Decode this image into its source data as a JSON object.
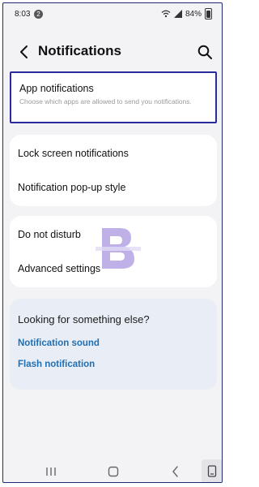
{
  "status_bar": {
    "time": "8:03",
    "notification_count": "2",
    "battery": "84%"
  },
  "header": {
    "title": "Notifications"
  },
  "app_notifications": {
    "label": "App notifications",
    "description": "Choose which apps are allowed to send you notifications."
  },
  "group1": [
    {
      "label": "Lock screen notifications"
    },
    {
      "label": "Notification pop-up style"
    }
  ],
  "group2": [
    {
      "label": "Do not disturb"
    },
    {
      "label": "Advanced settings"
    }
  ],
  "suggestions": {
    "heading": "Looking for something else?",
    "links": [
      {
        "label": "Notification sound"
      },
      {
        "label": "Flash notification"
      }
    ]
  },
  "watermark": {
    "letter": "B",
    "color": "#7a5cc9"
  },
  "colors": {
    "link": "#1f6fb3",
    "highlight_border": "#2a2a9c",
    "background": "#f3f3f6"
  },
  "icons": [
    "back-icon",
    "search-icon",
    "wifi-icon",
    "signal-icon",
    "battery-icon",
    "recent-apps-icon",
    "home-icon",
    "back-nav-icon",
    "keyboard-icon"
  ]
}
